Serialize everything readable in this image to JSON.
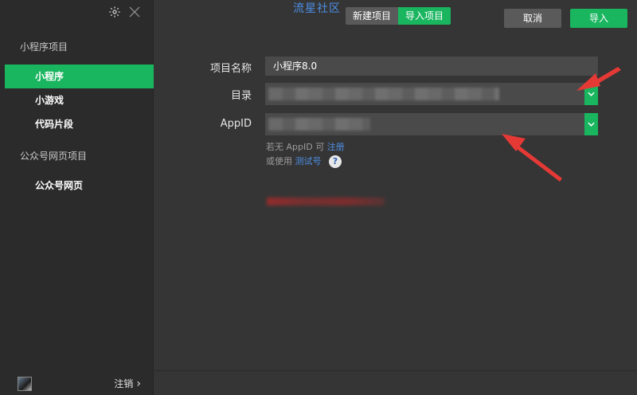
{
  "sidebar": {
    "section_miniprogram": "小程序项目",
    "items": [
      {
        "label": "小程序",
        "active": true
      },
      {
        "label": "小游戏",
        "active": false
      },
      {
        "label": "代码片段",
        "active": false
      }
    ],
    "section_official": "公众号网页项目",
    "official_items": [
      {
        "label": "公众号网页"
      }
    ],
    "logout_label": "注销",
    "logout_chevron": "›"
  },
  "header": {
    "brand": "流星社区",
    "tab_new": "新建项目",
    "tab_import": "导入项目"
  },
  "form": {
    "name_label": "项目名称",
    "name_value": "小程序8.0",
    "dir_label": "目录",
    "appid_label": "AppID",
    "hint_no_appid_prefix": "若无 AppID 可",
    "hint_register": "注册",
    "hint_or_use": "或使用",
    "hint_test_account": "测试号",
    "help_glyph": "?"
  },
  "footer": {
    "cancel_label": "取消",
    "import_label": "导入"
  },
  "colors": {
    "accent": "#19b55f",
    "link": "#4d8fe6",
    "annotation": "#e53935"
  }
}
